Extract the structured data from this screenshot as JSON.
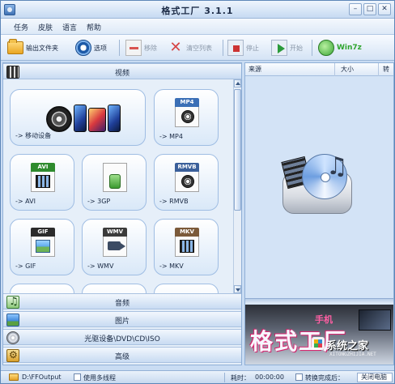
{
  "window": {
    "title": "格式工厂  3.1.1"
  },
  "menu": [
    "任务",
    "皮肤",
    "语言",
    "帮助"
  ],
  "toolbar": {
    "output_folder": "输出文件夹",
    "options": "选项",
    "remove": "移除",
    "clear_list": "清空列表",
    "stop": "停止",
    "start": "开始",
    "win7": "Win7z"
  },
  "categories": {
    "video": "视频",
    "audio": "音频",
    "picture": "图片",
    "rom": "光驱设备\\DVD\\CD\\ISO",
    "advanced": "高级"
  },
  "tiles": [
    {
      "label": "-> 移动设备",
      "icon": "mobile-device-icon"
    },
    {
      "label": "-> MP4",
      "tag": "MP4",
      "color": "#3b6fb6",
      "icon": "mp4-file-icon"
    },
    {
      "label": "-> AVI",
      "tag": "AVI",
      "color": "#2e8b2e",
      "icon": "avi-file-icon"
    },
    {
      "label": "-> 3GP",
      "tag": "",
      "color": "#3aa535",
      "icon": "3gp-file-icon"
    },
    {
      "label": "-> RMVB",
      "tag": "RMVB",
      "color": "#3a5f9a",
      "icon": "rmvb-file-icon"
    },
    {
      "label": "-> GIF",
      "tag": "GIF",
      "color": "#2b2b2b",
      "icon": "gif-file-icon"
    },
    {
      "label": "-> WMV",
      "tag": "WMV",
      "color": "#3b3b3b",
      "icon": "wmv-file-icon"
    },
    {
      "label": "-> MKV",
      "tag": "MKV",
      "color": "#7b5a3a",
      "icon": "mkv-file-icon"
    }
  ],
  "file_list": {
    "columns": [
      "来源",
      "大小",
      "转"
    ]
  },
  "preview": {
    "brand": "格式工厂",
    "brand_small": "手机",
    "watermark_cn": "系统之家",
    "watermark_en": "XITONGZHIJIA.NET"
  },
  "status": {
    "output_path": "D:\\FFOutput",
    "multithread": "使用多线程",
    "elapsed_label": "耗时：",
    "elapsed_value": "00:00:00",
    "after_convert_label": "转换完成后：",
    "after_convert_value": "关闭电脑"
  },
  "colors": {
    "accent": "#1d5aa8",
    "panel": "#e6eff9",
    "brand_pink": "#c2185b"
  }
}
